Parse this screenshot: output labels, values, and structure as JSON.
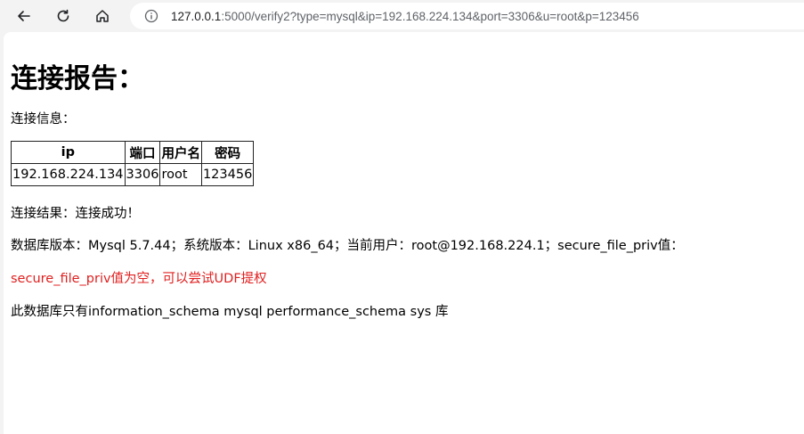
{
  "browser": {
    "url_host": "127.0.0.1",
    "url_rest": ":5000/verify2?type=mysql&ip=192.168.224.134&port=3306&u=root&p=123456"
  },
  "page": {
    "title": "连接报告：",
    "info_label": "连接信息：",
    "table": {
      "headers": [
        "ip",
        "端口",
        "用户名",
        "密码"
      ],
      "row": [
        "192.168.224.134",
        "3306",
        "root",
        "123456"
      ]
    },
    "result_line": "连接结果：连接成功！",
    "version_line": "数据库版本：Mysql 5.7.44；系统版本：Linux x86_64；当前用户：root@192.168.224.1；secure_file_priv值：",
    "priv_message": "secure_file_priv值为空，可以尝试UDF提权",
    "databases_line": "此数据库只有information_schema mysql performance_schema sys 库"
  },
  "colors": {
    "warning_text": "#e02020"
  }
}
